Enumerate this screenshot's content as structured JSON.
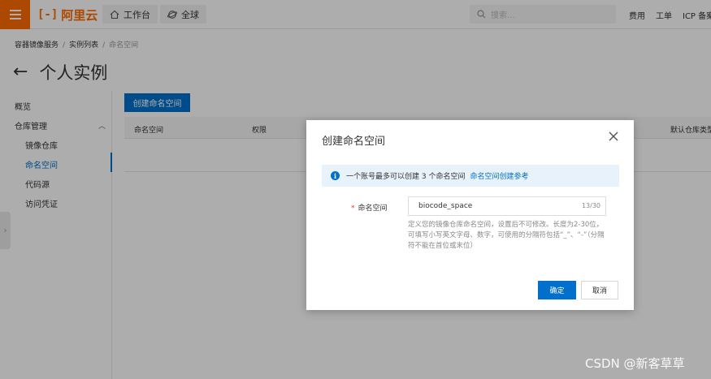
{
  "topbar": {
    "logo_text": "阿里云",
    "logo_mark": "[-]",
    "workbench": "工作台",
    "region": "全球",
    "search_placeholder": "搜索...",
    "links": [
      "费用",
      "工单",
      "ICP 备案"
    ]
  },
  "breadcrumb": [
    "容器镜像服务",
    "实例列表",
    "命名空间"
  ],
  "page_title": "个人实例",
  "sidebar": {
    "overview": "概览",
    "group": "仓库管理",
    "items": [
      "镜像仓库",
      "命名空间",
      "代码源",
      "访问凭证"
    ],
    "active_index": 1
  },
  "main": {
    "create_button": "创建命名空间",
    "columns": [
      "命名空间",
      "权限",
      "默认仓库类型"
    ]
  },
  "modal": {
    "title": "创建命名空间",
    "notice_text": "一个账号最多可以创建 3 个命名空间",
    "notice_link": "命名空间创建参考",
    "field_label": "命名空间",
    "field_value": "biocode_space",
    "field_counter": "13/30",
    "field_help": "定义您的镜像仓库命名空间，设置后不可修改。长度为2-30位，可填写小写英文字母、数字，可使用的分隔符包括“_”、“-”（分隔符不能在首位或末位）",
    "ok_label": "确定",
    "cancel_label": "取消"
  },
  "watermark": "CSDN @新客草草",
  "colors": {
    "brand": "#ff6a00",
    "primary": "#0070cc"
  }
}
